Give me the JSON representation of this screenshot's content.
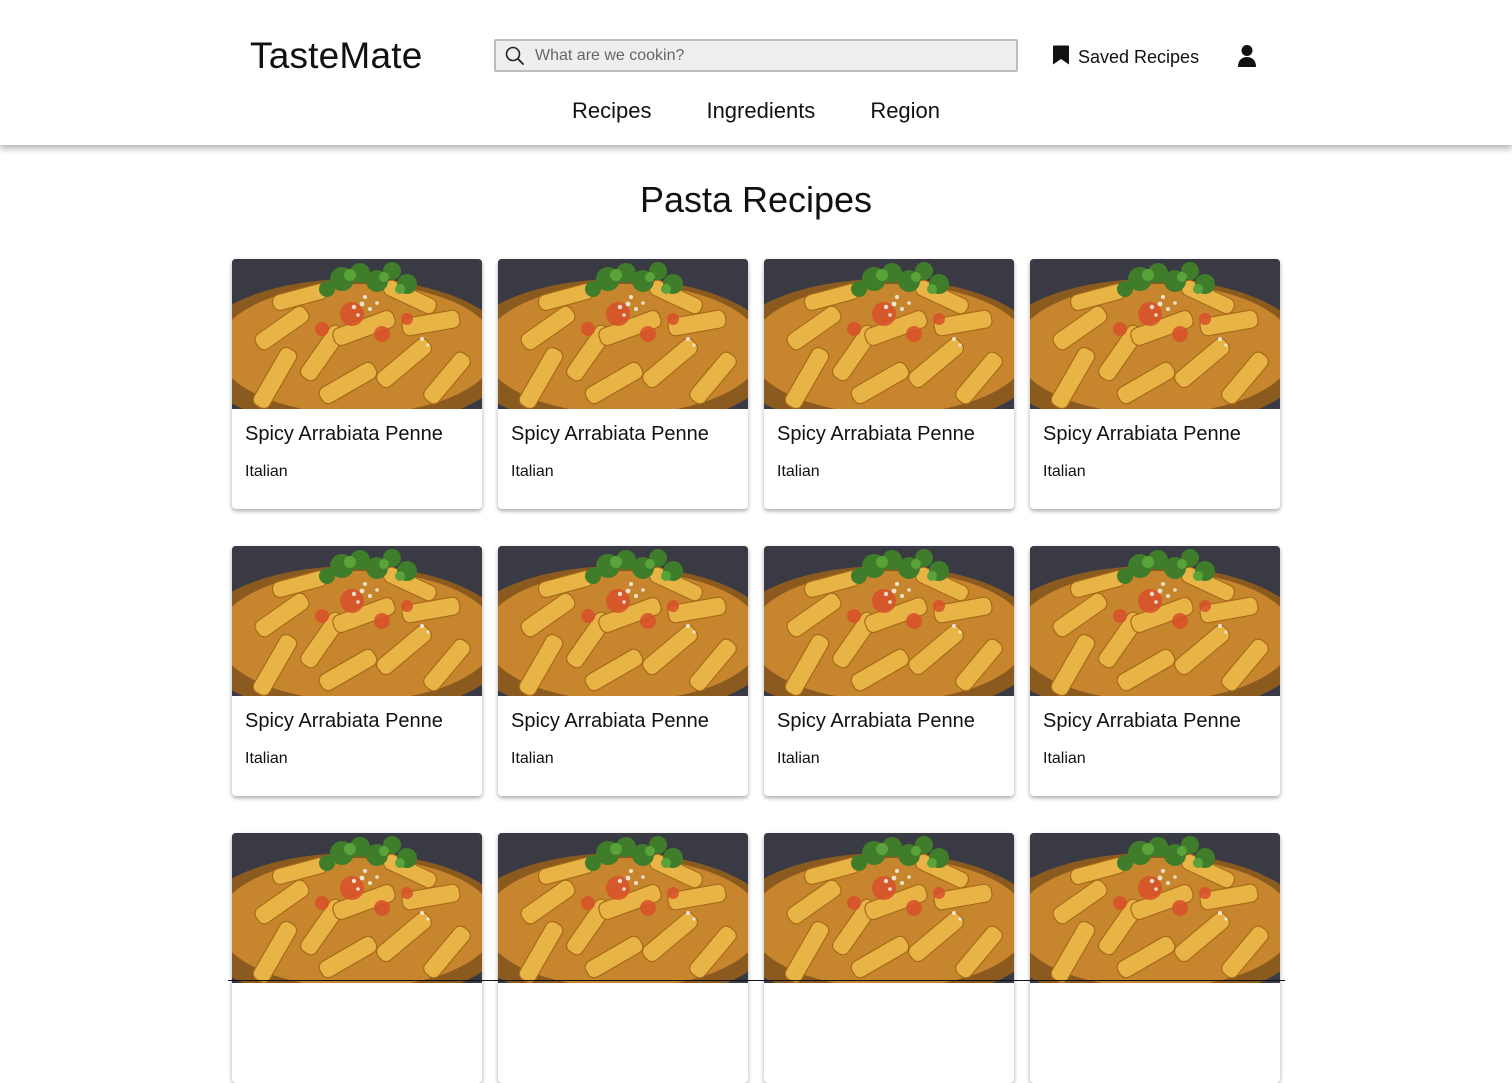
{
  "header": {
    "logo": "TasteMate",
    "search_placeholder": "What are we cookin?",
    "saved_label": "Saved Recipes",
    "nav": [
      "Recipes",
      "Ingredients",
      "Region"
    ]
  },
  "main": {
    "title": "Pasta Recipes",
    "cards": [
      {
        "title": "Spicy Arrabiata Penne",
        "cuisine": "Italian"
      },
      {
        "title": "Spicy Arrabiata Penne",
        "cuisine": "Italian"
      },
      {
        "title": "Spicy Arrabiata Penne",
        "cuisine": "Italian"
      },
      {
        "title": "Spicy Arrabiata Penne",
        "cuisine": "Italian"
      },
      {
        "title": "Spicy Arrabiata Penne",
        "cuisine": "Italian"
      },
      {
        "title": "Spicy Arrabiata Penne",
        "cuisine": "Italian"
      },
      {
        "title": "Spicy Arrabiata Penne",
        "cuisine": "Italian"
      },
      {
        "title": "Spicy Arrabiata Penne",
        "cuisine": "Italian"
      },
      {
        "title": "",
        "cuisine": ""
      },
      {
        "title": "",
        "cuisine": ""
      },
      {
        "title": "",
        "cuisine": ""
      },
      {
        "title": "",
        "cuisine": ""
      }
    ]
  },
  "icons": {
    "search": "search-icon",
    "saved": "bookmark-icon",
    "account": "user-icon"
  },
  "colors": {
    "background": "#ffffff",
    "search_bg": "#eeeeee",
    "text": "#111111"
  }
}
